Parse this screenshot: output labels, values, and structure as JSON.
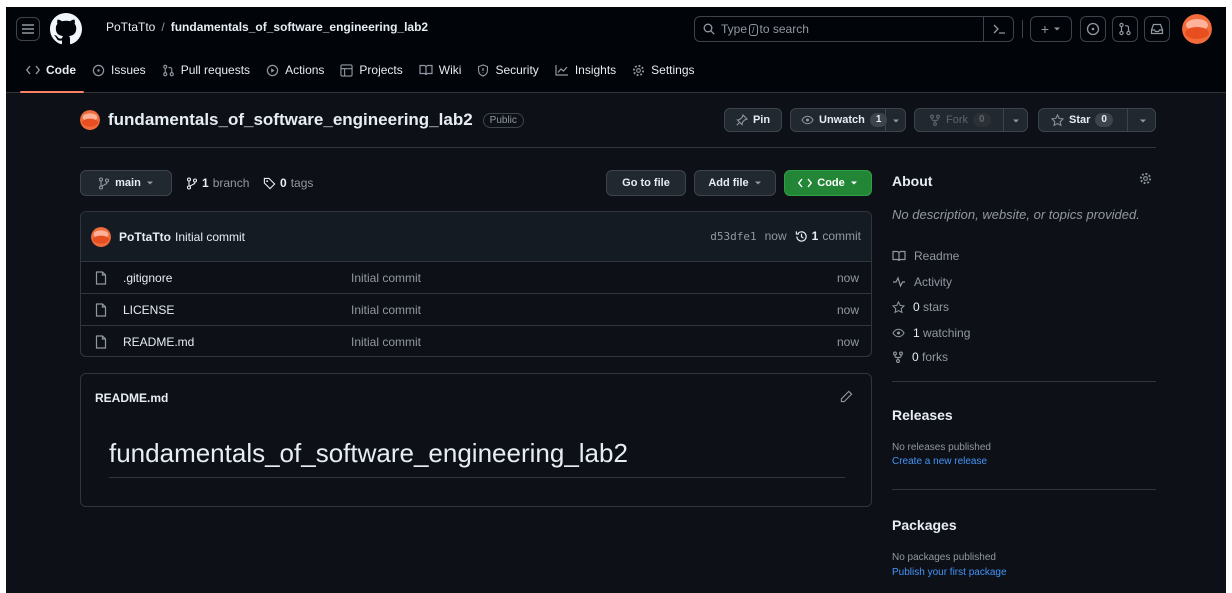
{
  "header": {
    "owner": "PoTtaTto",
    "separator": "/",
    "repo": "fundamentals_of_software_engineering_lab2",
    "search_before": "Type",
    "search_key": "/",
    "search_after": "to search",
    "plus_label": "+"
  },
  "nav": {
    "tabs": [
      {
        "label": "Code",
        "icon": "code-icon"
      },
      {
        "label": "Issues",
        "icon": "issue-opened-icon"
      },
      {
        "label": "Pull requests",
        "icon": "git-pull-request-icon"
      },
      {
        "label": "Actions",
        "icon": "play-icon"
      },
      {
        "label": "Projects",
        "icon": "table-icon"
      },
      {
        "label": "Wiki",
        "icon": "book-icon"
      },
      {
        "label": "Security",
        "icon": "shield-icon"
      },
      {
        "label": "Insights",
        "icon": "graph-icon"
      },
      {
        "label": "Settings",
        "icon": "gear-icon"
      }
    ],
    "active_tab": "Code"
  },
  "repo": {
    "name": "fundamentals_of_software_engineering_lab2",
    "visibility": "Public",
    "pin_label": "Pin",
    "unwatch_label": "Unwatch",
    "watch_count": "1",
    "fork_label": "Fork",
    "fork_count": "0",
    "star_label": "Star",
    "star_count": "0"
  },
  "browser": {
    "branch_name": "main",
    "branch_count": "1",
    "branch_word": "branch",
    "tag_count": "0",
    "tag_word": "tags",
    "go_to_file_label": "Go to file",
    "add_file_label": "Add file",
    "code_label": "Code"
  },
  "commit": {
    "author": "PoTtaTto",
    "message": "Initial commit",
    "hash": "d53dfe1",
    "time": "now",
    "count": "1",
    "count_word": "commit"
  },
  "files": [
    {
      "name": ".gitignore",
      "message": "Initial commit",
      "age": "now"
    },
    {
      "name": "LICENSE",
      "message": "Initial commit",
      "age": "now"
    },
    {
      "name": "README.md",
      "message": "Initial commit",
      "age": "now"
    }
  ],
  "readme": {
    "label": "README.md",
    "heading": "fundamentals_of_software_engineering_lab2"
  },
  "sidebar": {
    "about_title": "About",
    "description": "No description, website, or topics provided.",
    "readme_label": "Readme",
    "activity_label": "Activity",
    "stars_count": "0",
    "stars_word": "stars",
    "watching_count": "1",
    "watching_word": "watching",
    "forks_count": "0",
    "forks_word": "forks",
    "releases_title": "Releases",
    "releases_empty": "No releases published",
    "releases_link": "Create a new release",
    "packages_title": "Packages",
    "packages_empty": "No packages published",
    "packages_link": "Publish your first package"
  },
  "colors": {
    "background": "#0d1117",
    "header": "#010409",
    "accent_tab": "#f78166",
    "primary_button": "#238636",
    "link": "#4493f8",
    "avatar": "#f26b3a"
  }
}
